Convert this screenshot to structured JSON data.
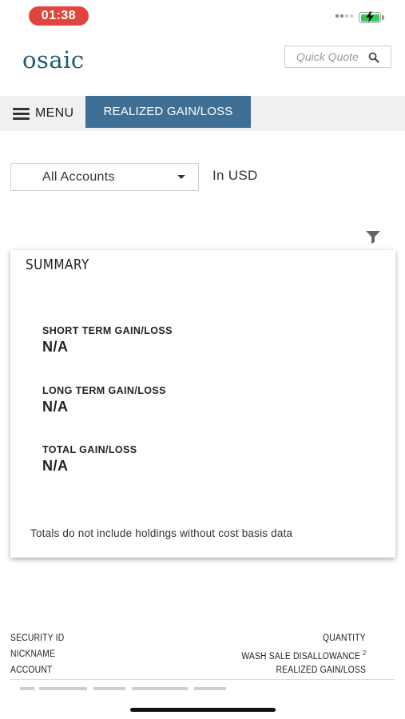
{
  "status_bar": {
    "time": "01:38",
    "signal_icon": "cellular-signal-icon",
    "battery_icon": "battery-charging-icon",
    "battery_color": "#35c759"
  },
  "header": {
    "logo_text": "osaic",
    "logo_color": "#1f5c6e",
    "search": {
      "placeholder": "Quick Quote",
      "value": "",
      "icon": "search-icon"
    }
  },
  "nav": {
    "menu_label": "MENU",
    "menu_icon": "hamburger-menu-icon",
    "active_tab_label": "REALIZED GAIN/LOSS",
    "active_tab_color": "#3f6f94"
  },
  "filters": {
    "account_selected": "All Accounts",
    "currency_label": "In USD",
    "filter_icon": "filter-funnel-icon"
  },
  "summary": {
    "title": "SUMMARY",
    "metrics": [
      {
        "label": "SHORT TERM GAIN/LOSS",
        "value": "N/A"
      },
      {
        "label": "LONG TERM GAIN/LOSS",
        "value": "N/A"
      },
      {
        "label": "TOTAL GAIN/LOSS",
        "value": "N/A"
      }
    ],
    "footnote": "Totals do not include holdings without cost basis data"
  },
  "table": {
    "left_headers": [
      "SECURITY ID",
      "NICKNAME",
      "ACCOUNT"
    ],
    "right_headers": [
      "QUANTITY",
      "WASH SALE DISALLOWANCE",
      "REALIZED GAIN/LOSS"
    ],
    "wash_sale_superscript": "2"
  }
}
